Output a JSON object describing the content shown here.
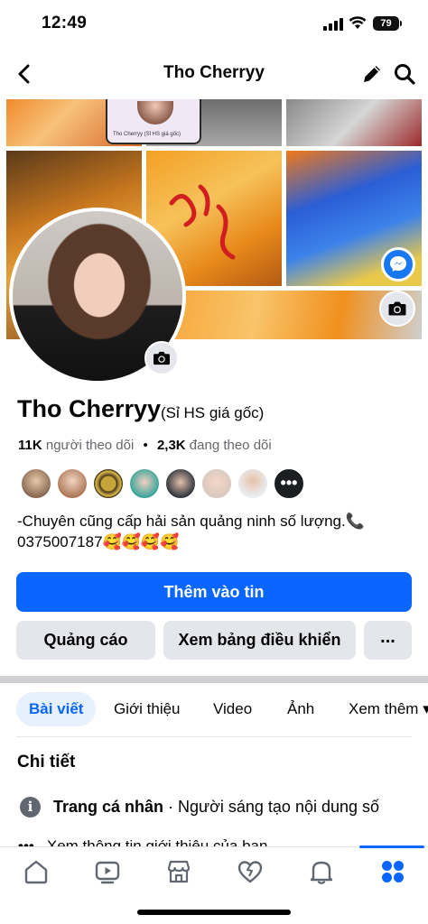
{
  "status_bar": {
    "time": "12:49",
    "battery": "79"
  },
  "nav": {
    "title": "Tho Cherryy"
  },
  "cover": {
    "caption": "Tho Cherryy (Sỉ HS giá gốc)"
  },
  "profile": {
    "name": "Tho Cherryy",
    "alt_name": "(Sỉ HS giá gốc)",
    "followers_count": "11K",
    "followers_label": "người theo dõi",
    "separator": "•",
    "following_count": "2,3K",
    "following_label": "đang theo dõi",
    "bio_line1": "-Chuyên cũng cấp hải sản quảng ninh số lượng.📞",
    "bio_line2": "0375007187🥰🥰🥰🥰"
  },
  "friends": {
    "more_label": "•••"
  },
  "buttons": {
    "add_story": "Thêm vào tin",
    "ads": "Quảng cáo",
    "dashboard": "Xem bảng điều khiển",
    "more": "..."
  },
  "tabs": [
    {
      "label": "Bài viết",
      "active": true
    },
    {
      "label": "Giới thiệu",
      "active": false
    },
    {
      "label": "Video",
      "active": false
    },
    {
      "label": "Ảnh",
      "active": false
    },
    {
      "label": "Xem thêm ▾",
      "active": false
    }
  ],
  "details": {
    "title": "Chi tiết",
    "page_type_label": "Trang cá nhân",
    "page_type_value": " · Người sáng tạo nội dung số",
    "info_link": "Xem thông tin giới thiệu của bạn"
  },
  "icons": {
    "back": "chevron-left-icon",
    "edit": "pencil-icon",
    "search": "search-icon",
    "camera": "camera-icon",
    "messenger": "messenger-icon",
    "info": "info-icon",
    "bottom": [
      "home-icon",
      "video-icon",
      "marketplace-icon",
      "dating-heart-icon",
      "bell-icon",
      "menu-grid-icon"
    ]
  },
  "colors": {
    "accent": "#0866ff",
    "button_bg": "#e4e6eb",
    "tab_active_bg": "#e7f0fd"
  }
}
